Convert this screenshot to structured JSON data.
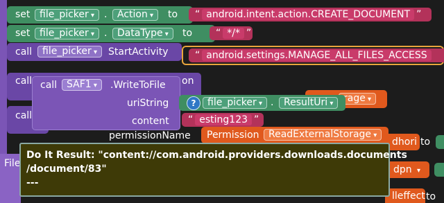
{
  "blocks": {
    "row1": {
      "keyword": "set",
      "component": "file_picker",
      "property": "Action",
      "to_label": "to",
      "value": "android.intent.action.CREATE_DOCUMENT"
    },
    "row2": {
      "keyword": "set",
      "component": "file_picker",
      "property": "DataType",
      "to_label": "to",
      "value": "*/*"
    },
    "row3": {
      "keyword": "call",
      "component": "file_picker",
      "method": "StartActivity",
      "value": "android.settings.MANAGE_ALL_FILES_ACCESS"
    },
    "behind": {
      "call_a": "call",
      "call_b": "call",
      "on_fragment": "on",
      "storage_fragment": "rage",
      "permission_name_label": "permissionName",
      "permission_block": "Permission",
      "permission_value": "ReadExternalStorage",
      "fragment_dhori": "dhori",
      "fragment_dpn": "dpn",
      "fragment_lleffect": "lleffect",
      "to_label": "to",
      "file_fragment": "File"
    },
    "write_file": {
      "keyword": "call",
      "component": "SAF1",
      "method": ".WriteToFile",
      "uri_label": "uriString",
      "uri_component": "file_picker",
      "uri_property": "ResultUri",
      "content_label": "content",
      "content_value": "esting123"
    }
  },
  "do_it_result": {
    "line1": "Do It Result: \"content://com.android.providers.downloads.documents",
    "line2": "/document/83\"",
    "line3": "---"
  },
  "icons": {
    "help": "?"
  },
  "colors": {
    "event_purple": "#7b55b6",
    "setter_green": "#3f8e62",
    "text_pink": "#b3325a",
    "permission_orange": "#e0591d",
    "bubble_bg": "#3e3a07"
  }
}
